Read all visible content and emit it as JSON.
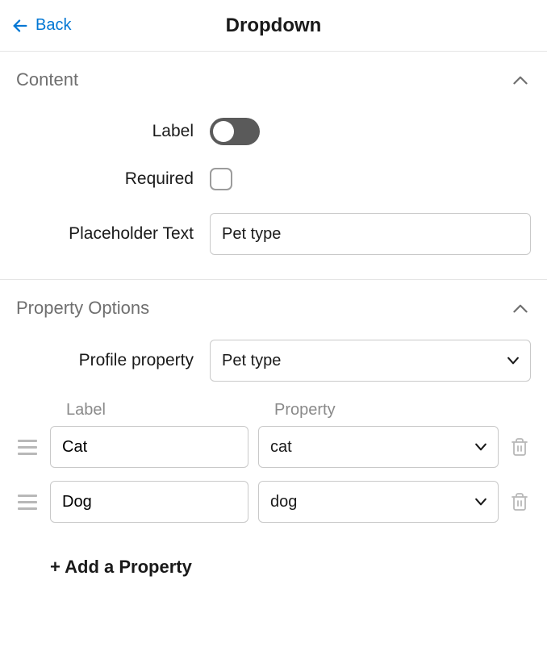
{
  "header": {
    "back_label": "Back",
    "title": "Dropdown"
  },
  "sections": {
    "content": {
      "title": "Content",
      "fields": {
        "label": {
          "label": "Label",
          "toggle_on": false
        },
        "required": {
          "label": "Required",
          "checked": false
        },
        "placeholder": {
          "label": "Placeholder Text",
          "value": "Pet type"
        }
      }
    },
    "property_options": {
      "title": "Property Options",
      "profile_property": {
        "label": "Profile property",
        "value": "Pet type"
      },
      "columns": {
        "label": "Label",
        "property": "Property"
      },
      "rows": [
        {
          "label": "Cat",
          "property": "cat"
        },
        {
          "label": "Dog",
          "property": "dog"
        }
      ],
      "add_label": "+ Add a Property"
    }
  }
}
